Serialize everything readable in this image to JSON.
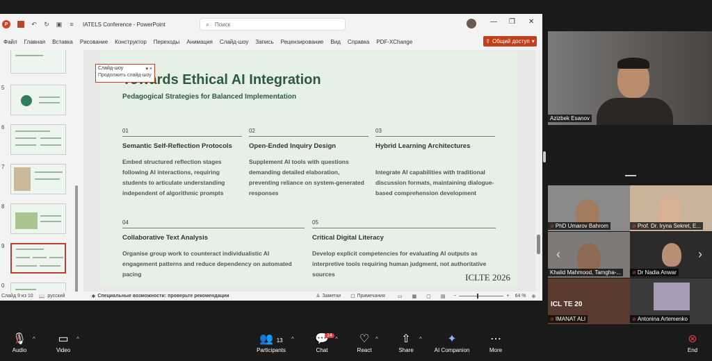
{
  "powerpoint": {
    "doc_title": "IATELS Conference  -  PowerPoint",
    "search_placeholder": "Поиск",
    "menu": [
      "Файл",
      "Главная",
      "Вставка",
      "Рисование",
      "Конструктор",
      "Переходы",
      "Анимация",
      "Слайд-шоу",
      "Запись",
      "Рецензирование",
      "Вид",
      "Справка",
      "PDF-XChange"
    ],
    "share_label": "Общий доступ",
    "slideshow_popup": {
      "title": "Слайд-шоу",
      "item": "Продолжить слайд-шоу"
    },
    "thumbnail_numbers": [
      "5",
      "6",
      "7",
      "8",
      "9",
      "0"
    ],
    "status": {
      "slide": "Слайд 9 из 10",
      "language": "русский",
      "accessibility": "Специальные возможности: проверьте рекомендации",
      "notes": "Заметки",
      "comments": "Примечания",
      "zoom": "64 %"
    }
  },
  "slide": {
    "title": "Towards Ethical AI Integration",
    "subtitle": "Pedagogical Strategies for Balanced Implementation",
    "items": [
      {
        "num": "01",
        "head": "Semantic Self-Reflection Protocols",
        "body": "Embed structured reflection stages following AI interactions, requiring students to articulate understanding independent of algorithmic prompts"
      },
      {
        "num": "02",
        "head": "Open-Ended Inquiry Design",
        "body": "Supplement AI tools with questions demanding detailed elaboration, preventing reliance on system-generated responses"
      },
      {
        "num": "03",
        "head": "Hybrid Learning Architectures",
        "body": "Integrate AI capabilities with traditional discussion formats, maintaining dialogue-based comprehension development"
      },
      {
        "num": "04",
        "head": "Collaborative Text Analysis",
        "body": "Organise group work to counteract individualistic AI engagement patterns and reduce dependency on automated pacing"
      },
      {
        "num": "05",
        "head": "Critical Digital Literacy",
        "body": "Develop explicit competencies for evaluating AI outputs as interpretive tools requiring human judgment, not authoritative sources"
      }
    ],
    "footer": "ICLTE 2026"
  },
  "zoom": {
    "main_speaker": "Azizbek Esanov",
    "participants": [
      "PhD Umarov Bahrom",
      "Prof. Dr. Iryna Sekret, E...",
      "Khalid Mahmood, Tamgha-...",
      "Dr Nadia Anwar",
      "IMANAT ALI",
      "Antonina Artemenko"
    ],
    "tile_poster_text": "ICL TE 20",
    "toolbar": {
      "audio": "Audio",
      "video": "Video",
      "participants": "Participants",
      "participants_count": "13",
      "chat": "Chat",
      "chat_badge": "14",
      "react": "React",
      "share": "Share",
      "ai": "AI Companion",
      "more": "More",
      "end": "End"
    }
  }
}
